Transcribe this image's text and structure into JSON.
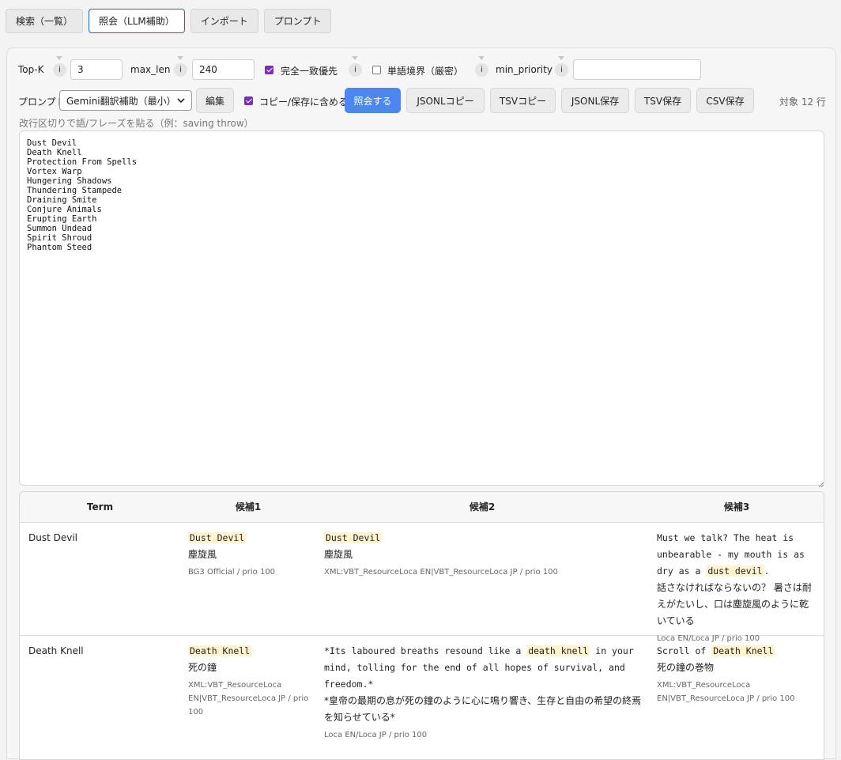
{
  "tabs": [
    {
      "label": "検索（一覧）"
    },
    {
      "label": "照会（LLM補助）"
    },
    {
      "label": "インポート"
    },
    {
      "label": "プロンプト"
    }
  ],
  "controls": {
    "topk_label": "Top-K",
    "topk_value": "3",
    "maxlen_label": "max_len",
    "maxlen_value": "240",
    "exact_label": "完全一致優先",
    "exact_checked": true,
    "word_boundary_label": "単語境界（厳密）",
    "word_boundary_checked": false,
    "min_priority_label": "min_priority",
    "min_priority_value": "",
    "info_glyph": "i",
    "prompt_label": "プロンプト",
    "prompt_selected": "Gemini翻訳補助（最小）",
    "edit_label": "編集",
    "include_label": "コピー/保存に含める",
    "include_checked": true,
    "query_button": "照会する",
    "jsonl_copy": "JSONLコピー",
    "tsv_copy": "TSVコピー",
    "jsonl_save": "JSONL保存",
    "tsv_save": "TSV保存",
    "csv_save": "CSV保存",
    "target_count": "対象 12 行",
    "hint": "改行区切りで語/フレーズを貼る（例：saving throw）"
  },
  "input_text": "Dust Devil\nDeath Knell\nProtection From Spells\nVortex Warp\nHungering Shadows\nThundering Stampede\nDraining Smite\nConjure Animals\nErupting Earth\nSummon Undead\nSpirit Shroud\nPhantom Steed",
  "table": {
    "headers": [
      "Term",
      "候補1",
      "候補2",
      "候補3"
    ],
    "rows": [
      {
        "term": "Dust Devil",
        "c1": {
          "en": "Dust Devil",
          "jp": "塵旋風",
          "src": "BG3 Official / prio 100"
        },
        "c2": {
          "en": "Dust Devil",
          "jp": "塵旋風",
          "src": "XML:VBT_ResourceLoca EN|VBT_ResourceLoca JP / prio 100"
        },
        "c3": {
          "en_pre": "Must we talk? The heat is unbearable - my mouth is as dry as a ",
          "en_hl": "dust devil",
          "en_post": ".",
          "jp": "話さなければならないの？ 暑さは耐えがたいし、口は塵旋風のように乾いている",
          "src": "Loca EN/Loca JP / prio 100"
        }
      },
      {
        "term": "Death Knell",
        "c1": {
          "en": "Death Knell",
          "jp": "死の鐘",
          "src": "XML:VBT_ResourceLoca EN|VBT_ResourceLoca JP / prio 100"
        },
        "c2": {
          "en_pre": "*Its laboured breaths resound like a ",
          "en_hl": "death knell",
          "en_post": " in your mind, tolling for the end of all hopes of survival, and freedom.*",
          "jp": "*皇帝の最期の息が死の鐘のように心に鳴り響き、生存と自由の希望の終焉を知らせている*",
          "src": "Loca EN/Loca JP / prio 100"
        },
        "c3": {
          "en_pre": "Scroll of ",
          "en_hl": "Death Knell",
          "en_post": "",
          "jp": "死の鐘の巻物",
          "src": "XML:VBT_ResourceLoca EN|VBT_ResourceLoca JP / prio 100"
        }
      }
    ]
  },
  "colors": {
    "accent": "#4c87f0",
    "checkbox": "#7a2fb6",
    "highlight": "#fff4cf",
    "active_tab_border": "#1f67c0"
  }
}
